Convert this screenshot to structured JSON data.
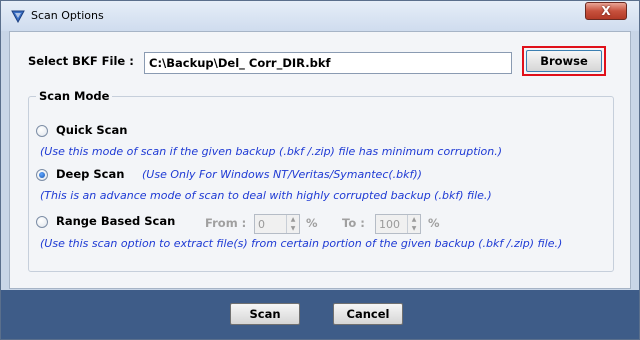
{
  "window": {
    "title": "Scan Options",
    "close_label": "X"
  },
  "file": {
    "label": "Select BKF File :",
    "value": "C:\\Backup\\Del_ Corr_DIR.bkf",
    "browse_label": "Browse"
  },
  "scan_mode": {
    "legend": "Scan Mode",
    "quick": {
      "label": "Quick Scan",
      "checked": false,
      "description": "(Use this mode of scan if the given backup (.bkf /.zip) file has minimum corruption.)"
    },
    "deep": {
      "label": "Deep Scan",
      "checked": true,
      "note": "(Use Only For Windows NT/Veritas/Symantec(.bkf))",
      "description": "(This is an advance mode of scan to deal with highly corrupted backup (.bkf) file.)"
    },
    "range": {
      "label": "Range Based Scan",
      "checked": false,
      "from_label": "From :",
      "from_value": "0",
      "from_unit": "%",
      "to_label": "To :",
      "to_value": "100",
      "to_unit": "%",
      "description": "(Use this scan option to extract file(s) from certain portion of the given backup (.bkf /.zip) file.)"
    }
  },
  "footer": {
    "scan_label": "Scan",
    "cancel_label": "Cancel"
  }
}
